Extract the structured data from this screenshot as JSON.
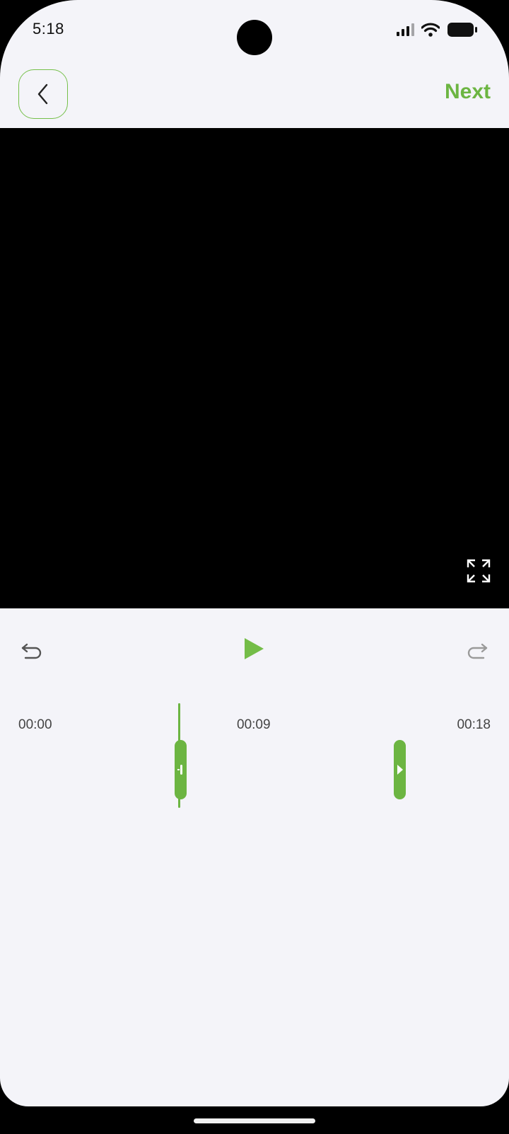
{
  "status_bar": {
    "time": "5:18",
    "icons": [
      "cellular-signal-icon",
      "wifi-icon",
      "battery-icon"
    ]
  },
  "nav": {
    "back_icon": "chevron-left-icon",
    "next_label": "Next"
  },
  "video": {
    "fullscreen_icon": "expand-icon"
  },
  "controls": {
    "undo_icon": "undo-icon",
    "play_icon": "play-icon",
    "redo_icon": "redo-icon"
  },
  "timeline": {
    "start_label": "00:00",
    "mid_label": "00:09",
    "end_label": "00:18"
  },
  "colors": {
    "accent": "#6cb542",
    "background": "#f4f4f9",
    "video_bg": "#000000"
  }
}
